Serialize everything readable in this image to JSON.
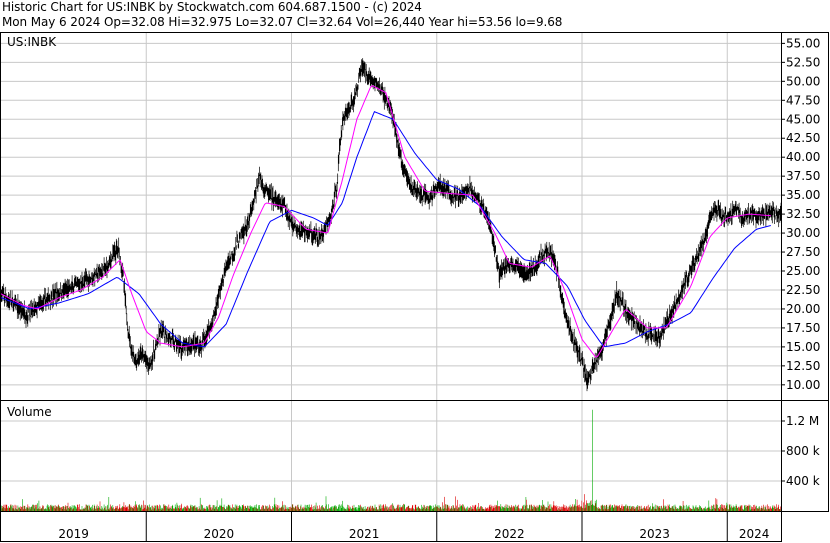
{
  "header": {
    "line1": "Historic Chart for US:INBK by Stockwatch.com 604.687.1500 - (c) 2024",
    "line2": "Mon May  6 2024   Op=32.08   Hi=32.975   Lo=32.07   Cl=32.64   Vol=26,440   Year hi=53.56   lo=9.68"
  },
  "price_panel": {
    "symbol_label": "US:INBK"
  },
  "volume_panel": {
    "label": "Volume"
  },
  "chart_data": [
    {
      "type": "line",
      "title": "",
      "series_style": "daily high-low price bars with two moving averages",
      "colors": {
        "price": "#000000",
        "ma_short": "#ff00ff",
        "ma_long": "#0000ff",
        "grid": "#c8c8c8"
      },
      "ylim": [
        8,
        56.5
      ],
      "y_ticks": [
        "55.00",
        "52.50",
        "50.00",
        "47.50",
        "45.00",
        "42.50",
        "40.00",
        "37.50",
        "35.00",
        "32.50",
        "30.00",
        "27.50",
        "25.00",
        "22.50",
        "20.00",
        "17.50",
        "15.00",
        "12.50",
        "10.00"
      ],
      "x_ticks": [
        "2019",
        "2020",
        "2021",
        "2022",
        "2023",
        "2024"
      ],
      "price_points": [
        [
          2019.0,
          22.0
        ],
        [
          2019.06,
          21.0
        ],
        [
          2019.12,
          20.2
        ],
        [
          2019.18,
          19.2
        ],
        [
          2019.24,
          20.0
        ],
        [
          2019.3,
          21.0
        ],
        [
          2019.38,
          22.0
        ],
        [
          2019.45,
          22.4
        ],
        [
          2019.52,
          23.0
        ],
        [
          2019.6,
          24.0
        ],
        [
          2019.66,
          24.5
        ],
        [
          2019.72,
          25.2
        ],
        [
          2019.77,
          27.0
        ],
        [
          2019.81,
          28.0
        ],
        [
          2019.84,
          24.5
        ],
        [
          2019.87,
          18.0
        ],
        [
          2019.9,
          14.5
        ],
        [
          2019.93,
          13.0
        ],
        [
          2019.97,
          14.0
        ],
        [
          2020.02,
          12.5
        ],
        [
          2020.06,
          14.5
        ],
        [
          2020.1,
          17.0
        ],
        [
          2020.14,
          16.5
        ],
        [
          2020.18,
          15.8
        ],
        [
          2020.25,
          14.8
        ],
        [
          2020.32,
          15.5
        ],
        [
          2020.38,
          15.0
        ],
        [
          2020.42,
          17.0
        ],
        [
          2020.46,
          18.5
        ],
        [
          2020.5,
          22.0
        ],
        [
          2020.56,
          26.0
        ],
        [
          2020.6,
          27.5
        ],
        [
          2020.66,
          30.0
        ],
        [
          2020.7,
          31.0
        ],
        [
          2020.74,
          34.0
        ],
        [
          2020.78,
          37.5
        ],
        [
          2020.81,
          36.0
        ],
        [
          2020.85,
          35.0
        ],
        [
          2020.9,
          34.0
        ],
        [
          2020.95,
          33.5
        ],
        [
          2021.0,
          31.5
        ],
        [
          2021.05,
          30.5
        ],
        [
          2021.1,
          30.2
        ],
        [
          2021.15,
          29.8
        ],
        [
          2021.19,
          29.2
        ],
        [
          2021.23,
          30.5
        ],
        [
          2021.27,
          32.0
        ],
        [
          2021.31,
          36.0
        ],
        [
          2021.34,
          43.0
        ],
        [
          2021.37,
          46.0
        ],
        [
          2021.4,
          46.5
        ],
        [
          2021.44,
          48.0
        ],
        [
          2021.48,
          52.0
        ],
        [
          2021.52,
          51.0
        ],
        [
          2021.56,
          50.0
        ],
        [
          2021.6,
          49.5
        ],
        [
          2021.64,
          48.0
        ],
        [
          2021.68,
          46.5
        ],
        [
          2021.72,
          43.0
        ],
        [
          2021.76,
          39.0
        ],
        [
          2021.8,
          37.0
        ],
        [
          2021.85,
          35.5
        ],
        [
          2021.9,
          35.0
        ],
        [
          2021.95,
          34.5
        ],
        [
          2022.0,
          36.0
        ],
        [
          2022.05,
          36.0
        ],
        [
          2022.1,
          35.0
        ],
        [
          2022.16,
          34.5
        ],
        [
          2022.22,
          36.0
        ],
        [
          2022.27,
          35.0
        ],
        [
          2022.32,
          33.0
        ],
        [
          2022.36,
          31.5
        ],
        [
          2022.4,
          28.0
        ],
        [
          2022.43,
          24.5
        ],
        [
          2022.46,
          25.5
        ],
        [
          2022.52,
          26.0
        ],
        [
          2022.58,
          25.0
        ],
        [
          2022.63,
          25.0
        ],
        [
          2022.68,
          25.5
        ],
        [
          2022.72,
          27.0
        ],
        [
          2022.76,
          27.5
        ],
        [
          2022.8,
          27.0
        ],
        [
          2022.84,
          24.0
        ],
        [
          2022.88,
          19.5
        ],
        [
          2022.92,
          17.0
        ],
        [
          2022.96,
          15.0
        ],
        [
          2023.0,
          13.0
        ],
        [
          2023.04,
          10.5
        ],
        [
          2023.08,
          12.5
        ],
        [
          2023.12,
          14.0
        ],
        [
          2023.16,
          16.0
        ],
        [
          2023.2,
          19.0
        ],
        [
          2023.24,
          22.0
        ],
        [
          2023.27,
          21.0
        ],
        [
          2023.31,
          19.5
        ],
        [
          2023.36,
          18.5
        ],
        [
          2023.42,
          17.0
        ],
        [
          2023.48,
          16.5
        ],
        [
          2023.54,
          16.5
        ],
        [
          2023.6,
          19.0
        ],
        [
          2023.66,
          21.0
        ],
        [
          2023.72,
          24.0
        ],
        [
          2023.78,
          26.0
        ],
        [
          2023.84,
          29.0
        ],
        [
          2023.88,
          32.0
        ],
        [
          2023.92,
          33.0
        ],
        [
          2023.96,
          32.5
        ],
        [
          2024.0,
          32.0
        ],
        [
          2024.06,
          33.5
        ],
        [
          2024.1,
          32.0
        ],
        [
          2024.16,
          32.5
        ],
        [
          2024.22,
          32.0
        ],
        [
          2024.3,
          32.6
        ]
      ],
      "ma_short_points": [
        [
          2019.0,
          22.0
        ],
        [
          2019.15,
          20.5
        ],
        [
          2019.25,
          20.0
        ],
        [
          2019.4,
          21.5
        ],
        [
          2019.55,
          22.5
        ],
        [
          2019.7,
          24.2
        ],
        [
          2019.82,
          26.5
        ],
        [
          2019.9,
          22.0
        ],
        [
          2020.0,
          17.0
        ],
        [
          2020.1,
          15.5
        ],
        [
          2020.25,
          15.0
        ],
        [
          2020.4,
          15.5
        ],
        [
          2020.5,
          19.0
        ],
        [
          2020.6,
          24.5
        ],
        [
          2020.72,
          30.0
        ],
        [
          2020.82,
          34.0
        ],
        [
          2020.95,
          33.5
        ],
        [
          2021.1,
          30.5
        ],
        [
          2021.25,
          30.0
        ],
        [
          2021.35,
          37.0
        ],
        [
          2021.45,
          45.0
        ],
        [
          2021.55,
          49.5
        ],
        [
          2021.65,
          48.5
        ],
        [
          2021.78,
          40.0
        ],
        [
          2021.92,
          35.5
        ],
        [
          2022.1,
          35.2
        ],
        [
          2022.25,
          35.0
        ],
        [
          2022.4,
          30.0
        ],
        [
          2022.5,
          26.0
        ],
        [
          2022.65,
          25.5
        ],
        [
          2022.78,
          27.0
        ],
        [
          2022.88,
          22.5
        ],
        [
          2023.0,
          16.0
        ],
        [
          2023.1,
          13.5
        ],
        [
          2023.22,
          17.5
        ],
        [
          2023.3,
          20.0
        ],
        [
          2023.45,
          17.5
        ],
        [
          2023.58,
          17.5
        ],
        [
          2023.75,
          23.0
        ],
        [
          2023.88,
          29.5
        ],
        [
          2024.0,
          32.0
        ],
        [
          2024.15,
          32.5
        ],
        [
          2024.3,
          32.3
        ]
      ],
      "ma_long_points": [
        [
          2019.0,
          21.5
        ],
        [
          2019.2,
          20.0
        ],
        [
          2019.4,
          20.8
        ],
        [
          2019.6,
          22.0
        ],
        [
          2019.8,
          24.2
        ],
        [
          2019.95,
          22.0
        ],
        [
          2020.1,
          18.0
        ],
        [
          2020.25,
          15.5
        ],
        [
          2020.4,
          15.0
        ],
        [
          2020.55,
          18.0
        ],
        [
          2020.7,
          25.0
        ],
        [
          2020.85,
          31.5
        ],
        [
          2021.0,
          33.0
        ],
        [
          2021.15,
          32.0
        ],
        [
          2021.25,
          31.0
        ],
        [
          2021.35,
          34.0
        ],
        [
          2021.45,
          40.0
        ],
        [
          2021.57,
          46.0
        ],
        [
          2021.7,
          45.0
        ],
        [
          2021.85,
          40.5
        ],
        [
          2022.0,
          37.0
        ],
        [
          2022.15,
          35.8
        ],
        [
          2022.3,
          33.5
        ],
        [
          2022.45,
          29.5
        ],
        [
          2022.6,
          26.5
        ],
        [
          2022.75,
          26.0
        ],
        [
          2022.9,
          23.0
        ],
        [
          2023.02,
          18.5
        ],
        [
          2023.15,
          15.0
        ],
        [
          2023.3,
          15.5
        ],
        [
          2023.45,
          17.0
        ],
        [
          2023.6,
          18.0
        ],
        [
          2023.75,
          19.5
        ],
        [
          2023.9,
          24.0
        ],
        [
          2024.05,
          28.0
        ],
        [
          2024.2,
          30.5
        ],
        [
          2024.3,
          31.0
        ]
      ]
    },
    {
      "type": "bar",
      "title": "",
      "ylim": [
        0,
        1400000
      ],
      "y_ticks": [
        "1.2 M",
        "800 k",
        "400 k"
      ],
      "y_tick_values": [
        1200000,
        800000,
        400000
      ],
      "colors": {
        "up": "#00aa00",
        "down": "#dd0000"
      },
      "spike": {
        "x": 2023.07,
        "value": 1350000
      },
      "typical_volume": 60000
    }
  ]
}
